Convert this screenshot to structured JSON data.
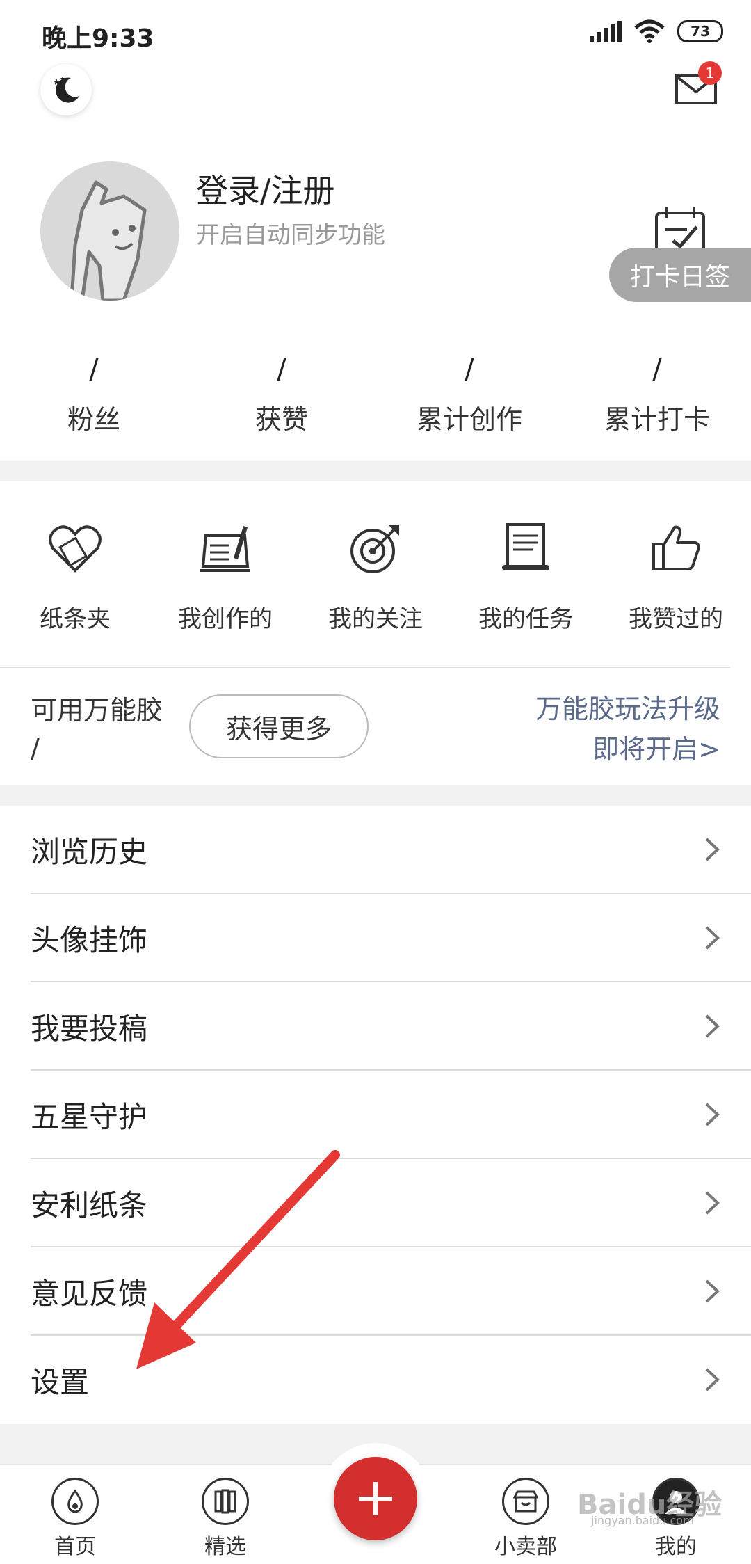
{
  "status_bar": {
    "time": "晚上9:33",
    "battery": "73"
  },
  "header": {
    "mail_badge": "1"
  },
  "profile": {
    "title": "登录/注册",
    "subtitle": "开启自动同步功能",
    "checkin_label": "打卡日签"
  },
  "stats": [
    {
      "value": "/",
      "label": "粉丝"
    },
    {
      "value": "/",
      "label": "获赞"
    },
    {
      "value": "/",
      "label": "累计创作"
    },
    {
      "value": "/",
      "label": "累计打卡"
    }
  ],
  "shortcuts": [
    {
      "label": "纸条夹",
      "icon": "heart-folder-icon"
    },
    {
      "label": "我创作的",
      "icon": "notebook-pen-icon"
    },
    {
      "label": "我的关注",
      "icon": "target-icon"
    },
    {
      "label": "我的任务",
      "icon": "scroll-icon"
    },
    {
      "label": "我赞过的",
      "icon": "thumbs-up-icon"
    }
  ],
  "glue": {
    "label": "可用万能胶",
    "value": "/",
    "button": "获得更多",
    "upgrade_line1": "万能胶玩法升级",
    "upgrade_line2": "即将开启>"
  },
  "menu": [
    {
      "label": "浏览历史"
    },
    {
      "label": "头像挂饰"
    },
    {
      "label": "我要投稿"
    },
    {
      "label": "五星守护"
    },
    {
      "label": "安利纸条"
    },
    {
      "label": "意见反馈"
    },
    {
      "label": "设置"
    }
  ],
  "bottom_nav": [
    {
      "label": "首页"
    },
    {
      "label": "精选"
    },
    {
      "label": "小卖部"
    },
    {
      "label": "我的"
    }
  ],
  "watermark": {
    "text": "Baidu经验",
    "sub": "jingyan.baidu.com"
  },
  "colors": {
    "accent_red": "#d32f2f",
    "link_blue": "#5a6a8a",
    "annotation_arrow": "#e53935"
  }
}
